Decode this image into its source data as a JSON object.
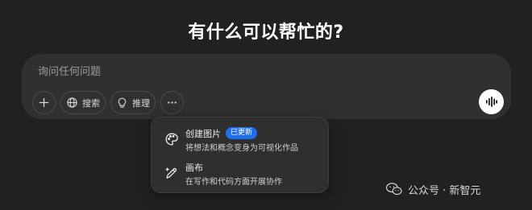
{
  "headline": "有什么可以帮忙的?",
  "composer": {
    "placeholder": "询问任何问题",
    "tools": {
      "search_label": "搜索",
      "reason_label": "推理"
    }
  },
  "menu": {
    "items": [
      {
        "title": "创建图片",
        "badge": "已更新",
        "description": "将想法和概念变身为可视化作品",
        "icon": "paint-palette-icon"
      },
      {
        "title": "画布",
        "description": "在写作和代码方面开展协作",
        "icon": "pen-sparkle-icon"
      }
    ]
  },
  "watermark": {
    "text": "公众号 · 新智元",
    "icon": "wechat-icon"
  },
  "colors": {
    "background": "#212121",
    "composer": "#303030",
    "menu": "#2f2f2f",
    "badge": "#1f6feb"
  }
}
